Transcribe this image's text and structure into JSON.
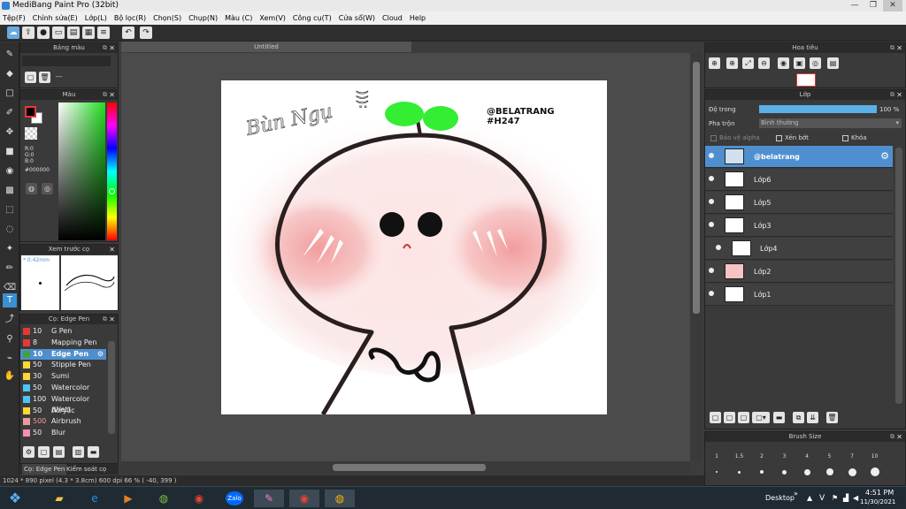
{
  "window": {
    "title": "MediBang Paint Pro (32bit)",
    "minimize": "—",
    "maximize": "❐",
    "close": "✕"
  },
  "menu": [
    "Tệp(F)",
    "Chỉnh sửa(E)",
    "Lớp(L)",
    "Bộ lọc(R)",
    "Chọn(S)",
    "Chụp(N)",
    "Màu (C)",
    "Xem(V)",
    "Công cụ(T)",
    "Cửa sổ(W)",
    "Cloud",
    "Help"
  ],
  "toolbar": {
    "icons": [
      "cloud-icon",
      "upload-icon",
      "speech-icon",
      "comment-icon",
      "page-icon",
      "grid-icon",
      "list-icon",
      "layers-icon",
      "undo-icon",
      "redo-icon"
    ]
  },
  "document": {
    "tab": "Untitled"
  },
  "panels": {
    "palette": {
      "title": "Bảng màu",
      "dash": "---"
    },
    "color": {
      "title": "Màu",
      "r": "R:0",
      "g": "G:0",
      "b": "B:0",
      "hex": "#000000"
    },
    "preview": {
      "title": "Xem trước cọ",
      "size": "* 0.42mm"
    },
    "brush": {
      "title": "Cọ: Edge Pen",
      "items": [
        {
          "size": "10",
          "name": "G Pen",
          "color": "#e53935"
        },
        {
          "size": "8",
          "name": "Mapping Pen",
          "color": "#e53935"
        },
        {
          "size": "10",
          "name": "Edge Pen",
          "color": "#43a047",
          "selected": true
        },
        {
          "size": "50",
          "name": "Stipple Pen",
          "color": "#fdd835"
        },
        {
          "size": "30",
          "name": "Sumi",
          "color": "#fdd835"
        },
        {
          "size": "50",
          "name": "Watercolor",
          "color": "#4fc3f7"
        },
        {
          "size": "100",
          "name": "Watercolor (Wet)",
          "color": "#4fc3f7"
        },
        {
          "size": "50",
          "name": "Acrylic",
          "color": "#fdd835"
        },
        {
          "size": "500",
          "name": "Airbrush",
          "color": "#ef9a9a"
        },
        {
          "size": "50",
          "name": "Blur",
          "color": "#f48fb1"
        }
      ],
      "tabs": [
        "Cọ: Edge Pen",
        "Kiểm soát cọ"
      ]
    },
    "navigator": {
      "title": "Hoa tiêu"
    },
    "layers": {
      "title": "Lớp",
      "opacity_label": "Độ trong",
      "opacity_value": "100 %",
      "blend_label": "Pha trộn",
      "blend_value": "Bình thường",
      "protect_alpha": "Bảo vệ alpha",
      "clipping": "Xén bớt",
      "lock": "Khóa",
      "items": [
        "@belatrang",
        "Lớp6",
        "Lớp5",
        "Lớp3",
        "Lớp4",
        "Lớp2",
        "Lớp1"
      ]
    },
    "brush_size": {
      "title": "Brush Size",
      "labels": [
        "1",
        "1.5",
        "2",
        "3",
        "4",
        "5",
        "7",
        "10"
      ]
    }
  },
  "artwork": {
    "text_left": "Bùn Ngụ",
    "text_top": ":(((",
    "handle": "@BELATRANG",
    "tag": "#H247"
  },
  "status": {
    "text": "1024 * 890 pixel  (4.3 * 3.8cm)  600 dpi  66 %  ( -40, 399 )"
  },
  "taskbar": {
    "desktop": "Desktop",
    "lang": "V",
    "time": "4:51 PM",
    "date": "11/30/2021",
    "zalo": "Zalo"
  },
  "colors": {
    "accent": "#4f8fcf",
    "sprout": "#33ee33",
    "blush": "#f2a6a6"
  }
}
